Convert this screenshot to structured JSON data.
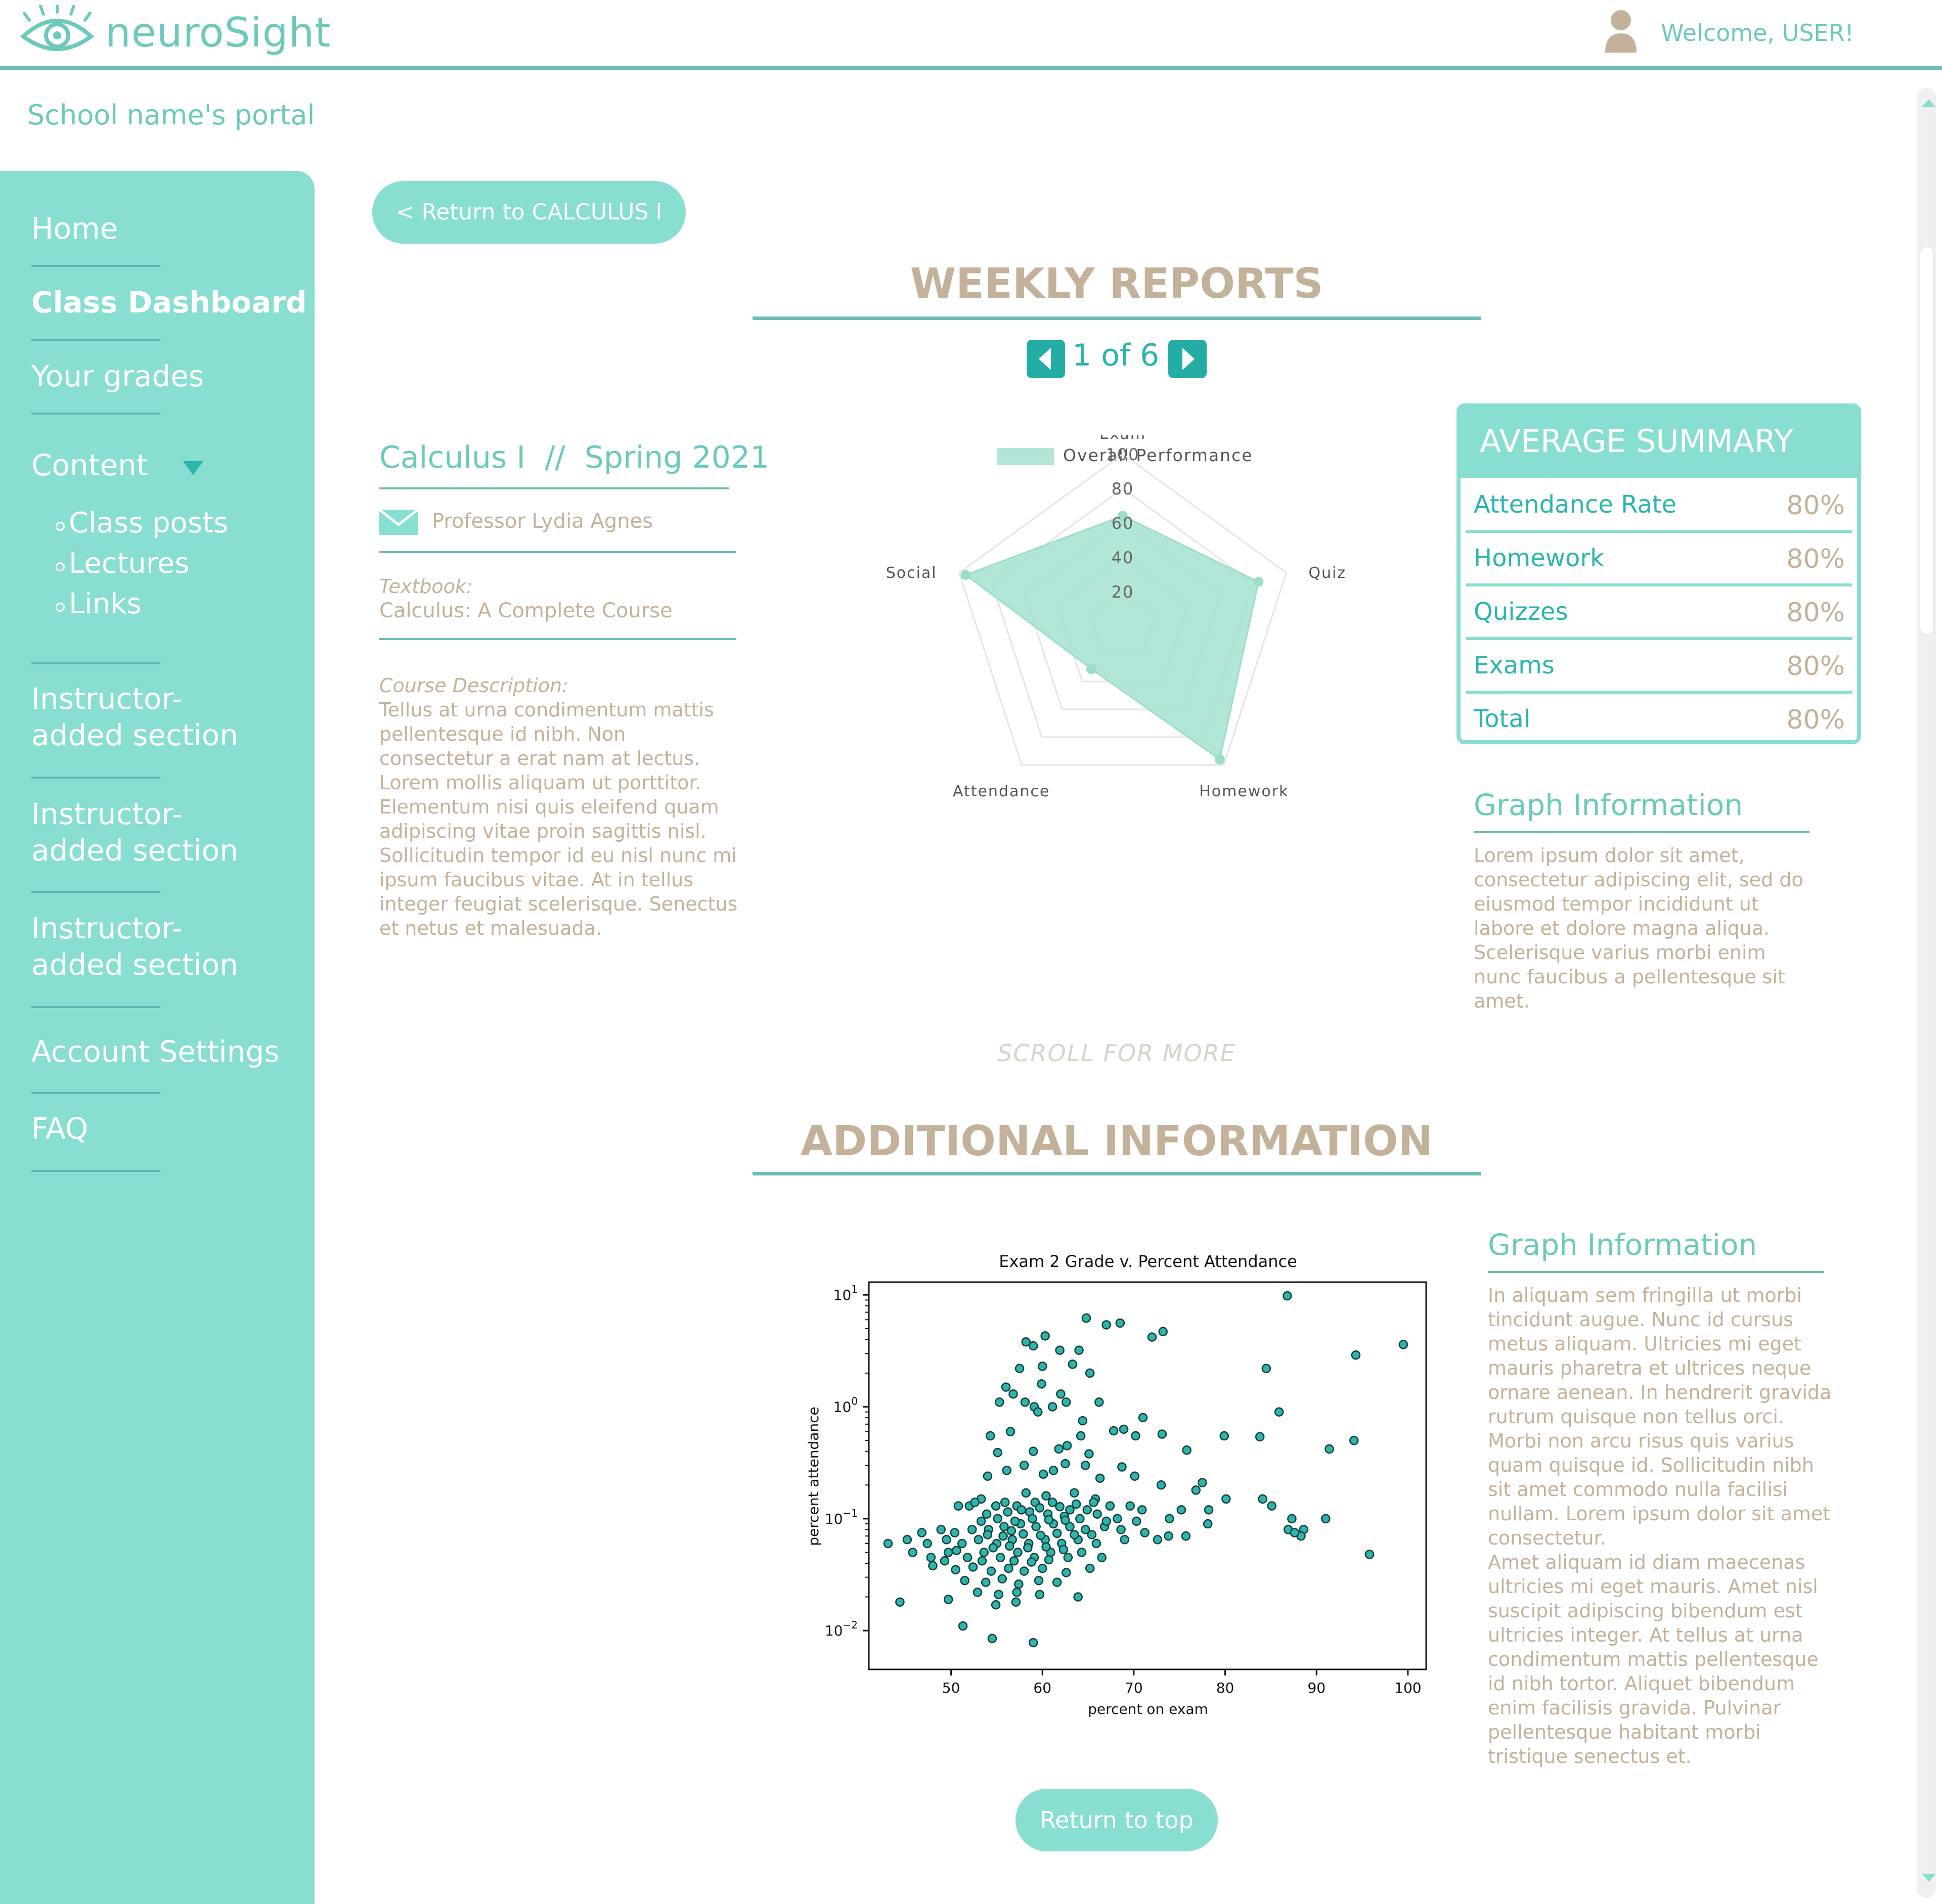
{
  "header": {
    "brand": "neuroSight",
    "welcome": "Welcome, USER!"
  },
  "portal_title": "School name's portal",
  "sidebar": {
    "items": [
      {
        "label": "Home"
      },
      {
        "label": "Class Dashboard"
      },
      {
        "label": "Your grades"
      },
      {
        "label": "Content"
      },
      {
        "label": "Instructor-added section"
      },
      {
        "label": "Instructor-added section"
      },
      {
        "label": "Instructor-added section"
      },
      {
        "label": "Account Settings"
      },
      {
        "label": "FAQ"
      }
    ],
    "content_subitems": [
      "Class posts",
      "Lectures",
      "Links"
    ]
  },
  "return_button": "< Return to CALCULUS I",
  "weekly": {
    "title": "WEEKLY REPORTS",
    "pager": "1 of 6"
  },
  "course": {
    "title": "Calculus I  //  Spring 2021",
    "professor": "Professor Lydia Agnes",
    "textbook_label": "Textbook:",
    "textbook": "Calculus: A Complete Course",
    "description_label": "Course Description:",
    "description": "Tellus at urna condimentum mattis pellentesque id nibh. Non consectetur a erat nam at lectus. Lorem mollis aliquam ut porttitor. Elementum nisi quis eleifend quam adipiscing vitae proin sagittis nisl. Sollicitudin tempor id eu nisl nunc mi ipsum faucibus vitae. At in tellus integer feugiat scelerisque. Senectus et netus et malesuada."
  },
  "summary": {
    "title": "AVERAGE SUMMARY",
    "rows": [
      {
        "label": "Attendance Rate",
        "value": "80%"
      },
      {
        "label": "Homework",
        "value": "80%"
      },
      {
        "label": "Quizzes",
        "value": "80%"
      },
      {
        "label": "Exams",
        "value": "80%"
      },
      {
        "label": "Total",
        "value": "80%"
      }
    ]
  },
  "graph_info_1": {
    "title": "Graph Information",
    "text": "Lorem ipsum dolor sit amet, consectetur adipiscing elit, sed do eiusmod tempor incididunt ut labore et dolore magna aliqua. Scelerisque varius morbi enim nunc faucibus a pellentesque sit amet."
  },
  "scroll_hint": "SCROLL FOR MORE",
  "additional": {
    "title": "ADDITIONAL INFORMATION"
  },
  "graph_info_2": {
    "title": "Graph Information",
    "text1": "In aliquam sem fringilla ut morbi tincidunt augue. Nunc id cursus metus aliquam. Ultricies mi eget mauris pharetra et ultrices neque ornare aenean. In hendrerit gravida rutrum quisque non tellus orci. Morbi non arcu risus quis varius quam quisque id. Sollicitudin nibh sit amet commodo nulla facilisi nullam. Lorem ipsum dolor sit amet consectetur.",
    "text2": "Amet aliquam id diam maecenas ultricies mi eget mauris. Amet nisl suscipit adipiscing bibendum est ultricies integer. At tellus at urna condimentum mattis pellentesque id nibh tortor. Aliquet bibendum enim facilisis gravida. Pulvinar pellentesque habitant morbi tristique senectus et."
  },
  "return_top": "Return to top",
  "colors": {
    "teal": "#88ded0",
    "teal_dark": "#24ada5",
    "tan": "#c3b19a"
  },
  "icons": [
    "eye-logo-icon",
    "user-icon",
    "mail-icon",
    "caret-down-icon",
    "chevron-left-icon",
    "chevron-right-icon"
  ],
  "chart_data": [
    {
      "type": "radar",
      "legend": "Overall Performance",
      "categories": [
        "Exam",
        "Quiz",
        "Homework",
        "Attendance",
        "Social"
      ],
      "values": [
        64,
        83,
        96,
        31,
        96
      ],
      "r_ticks": [
        "20",
        "40",
        "60",
        "80",
        "100"
      ],
      "range": [
        0,
        100
      ]
    },
    {
      "type": "scatter",
      "title": "Exam 2 Grade v. Percent Attendance",
      "xlabel": "percent on exam",
      "ylabel": "percent attendance",
      "x_ticks": [
        50,
        60,
        70,
        80,
        90,
        100
      ],
      "y_ticks": [
        "10",
        "10",
        "10"
      ],
      "y_tick_exponents": [
        "1",
        "0",
        "−1",
        "−2"
      ],
      "y_scale": "log",
      "xlim": [
        41,
        102
      ],
      "ylim": [
        0.0045,
        13
      ],
      "points": [
        [
          86.8,
          9.8
        ],
        [
          64.8,
          6.2
        ],
        [
          67.0,
          5.4
        ],
        [
          68.5,
          5.6
        ],
        [
          73.2,
          4.7
        ],
        [
          72.0,
          4.2
        ],
        [
          60.3,
          4.3
        ],
        [
          58.2,
          3.8
        ],
        [
          59.0,
          3.5
        ],
        [
          61.9,
          3.2
        ],
        [
          64.0,
          3.2
        ],
        [
          99.5,
          3.6
        ],
        [
          94.3,
          2.9
        ],
        [
          84.5,
          2.2
        ],
        [
          57.5,
          2.2
        ],
        [
          60.0,
          2.3
        ],
        [
          63.3,
          2.4
        ],
        [
          65.2,
          2.0
        ],
        [
          56.0,
          1.5
        ],
        [
          56.8,
          1.3
        ],
        [
          59.9,
          1.6
        ],
        [
          62.0,
          1.3
        ],
        [
          55.3,
          1.1
        ],
        [
          58.1,
          1.1
        ],
        [
          59.1,
          1.0
        ],
        [
          61.1,
          1.0
        ],
        [
          62.6,
          1.1
        ],
        [
          66.2,
          1.1
        ],
        [
          71.0,
          0.8
        ],
        [
          85.9,
          0.9
        ],
        [
          59.5,
          0.9
        ],
        [
          64.4,
          0.75
        ],
        [
          68.9,
          0.63
        ],
        [
          70.2,
          0.55
        ],
        [
          56.5,
          0.6
        ],
        [
          54.3,
          0.55
        ],
        [
          64.2,
          0.55
        ],
        [
          67.8,
          0.61
        ],
        [
          73.1,
          0.57
        ],
        [
          79.9,
          0.55
        ],
        [
          83.8,
          0.54
        ],
        [
          94.1,
          0.5
        ],
        [
          91.4,
          0.42
        ],
        [
          55.1,
          0.39
        ],
        [
          59.0,
          0.4
        ],
        [
          61.8,
          0.42
        ],
        [
          62.7,
          0.45
        ],
        [
          65.1,
          0.38
        ],
        [
          75.8,
          0.41
        ],
        [
          64.7,
          0.3
        ],
        [
          58.0,
          0.3
        ],
        [
          61.2,
          0.27
        ],
        [
          62.5,
          0.31
        ],
        [
          68.7,
          0.29
        ],
        [
          54.0,
          0.24
        ],
        [
          56.1,
          0.27
        ],
        [
          60.1,
          0.25
        ],
        [
          66.3,
          0.23
        ],
        [
          70.1,
          0.24
        ],
        [
          73.0,
          0.2
        ],
        [
          77.5,
          0.21
        ],
        [
          76.8,
          0.18
        ],
        [
          80.1,
          0.15
        ],
        [
          84.1,
          0.15
        ],
        [
          85.1,
          0.13
        ],
        [
          53.3,
          0.15
        ],
        [
          55.9,
          0.14
        ],
        [
          58.2,
          0.17
        ],
        [
          60.4,
          0.16
        ],
        [
          63.5,
          0.17
        ],
        [
          65.8,
          0.15
        ],
        [
          50.8,
          0.13
        ],
        [
          52.0,
          0.13
        ],
        [
          54.9,
          0.13
        ],
        [
          57.2,
          0.13
        ],
        [
          59.2,
          0.14
        ],
        [
          61.1,
          0.14
        ],
        [
          63.0,
          0.12
        ],
        [
          64.9,
          0.12
        ],
        [
          67.4,
          0.13
        ],
        [
          69.6,
          0.13
        ],
        [
          70.9,
          0.12
        ],
        [
          75.2,
          0.12
        ],
        [
          78.2,
          0.12
        ],
        [
          87.3,
          0.1
        ],
        [
          91.0,
          0.1
        ],
        [
          73.9,
          0.1
        ],
        [
          78.1,
          0.09
        ],
        [
          86.9,
          0.08
        ],
        [
          88.6,
          0.08
        ],
        [
          88.3,
          0.07
        ],
        [
          87.6,
          0.075
        ],
        [
          46.8,
          0.075
        ],
        [
          48.9,
          0.08
        ],
        [
          50.4,
          0.075
        ],
        [
          52.3,
          0.08
        ],
        [
          54.1,
          0.08
        ],
        [
          55.8,
          0.085
        ],
        [
          57.6,
          0.09
        ],
        [
          59.3,
          0.085
        ],
        [
          61.2,
          0.09
        ],
        [
          63.0,
          0.085
        ],
        [
          64.7,
          0.08
        ],
        [
          66.8,
          0.085
        ],
        [
          68.6,
          0.08
        ],
        [
          71.2,
          0.075
        ],
        [
          73.8,
          0.07
        ],
        [
          75.7,
          0.07
        ],
        [
          43.1,
          0.06
        ],
        [
          45.2,
          0.065
        ],
        [
          47.4,
          0.06
        ],
        [
          49.5,
          0.065
        ],
        [
          51.2,
          0.06
        ],
        [
          53.0,
          0.065
        ],
        [
          55.0,
          0.06
        ],
        [
          56.7,
          0.065
        ],
        [
          58.5,
          0.06
        ],
        [
          60.3,
          0.065
        ],
        [
          62.1,
          0.06
        ],
        [
          63.9,
          0.065
        ],
        [
          65.9,
          0.06
        ],
        [
          69.0,
          0.065
        ],
        [
          72.6,
          0.065
        ],
        [
          45.8,
          0.05
        ],
        [
          47.8,
          0.045
        ],
        [
          49.7,
          0.05
        ],
        [
          51.8,
          0.045
        ],
        [
          53.6,
          0.05
        ],
        [
          55.4,
          0.045
        ],
        [
          57.3,
          0.05
        ],
        [
          59.1,
          0.045
        ],
        [
          60.9,
          0.05
        ],
        [
          62.8,
          0.045
        ],
        [
          64.3,
          0.05
        ],
        [
          66.5,
          0.045
        ],
        [
          95.8,
          0.048
        ],
        [
          48.0,
          0.038
        ],
        [
          50.5,
          0.035
        ],
        [
          52.4,
          0.037
        ],
        [
          54.4,
          0.034
        ],
        [
          56.3,
          0.036
        ],
        [
          58.0,
          0.034
        ],
        [
          60.0,
          0.036
        ],
        [
          62.6,
          0.033
        ],
        [
          65.2,
          0.036
        ],
        [
          51.5,
          0.028
        ],
        [
          53.8,
          0.027
        ],
        [
          55.6,
          0.029
        ],
        [
          57.4,
          0.026
        ],
        [
          59.6,
          0.028
        ],
        [
          61.6,
          0.027
        ],
        [
          52.9,
          0.022
        ],
        [
          55.2,
          0.021
        ],
        [
          57.2,
          0.022
        ],
        [
          59.7,
          0.021
        ],
        [
          44.4,
          0.018
        ],
        [
          49.7,
          0.019
        ],
        [
          54.9,
          0.017
        ],
        [
          57.1,
          0.018
        ],
        [
          63.9,
          0.02
        ],
        [
          51.3,
          0.011
        ],
        [
          54.5,
          0.0085
        ],
        [
          59.0,
          0.0078
        ],
        [
          52.6,
          0.14
        ],
        [
          53.9,
          0.11
        ],
        [
          56.2,
          0.115
        ],
        [
          58.6,
          0.115
        ],
        [
          60.6,
          0.11
        ],
        [
          62.4,
          0.105
        ],
        [
          64.1,
          0.1
        ],
        [
          66.0,
          0.11
        ],
        [
          55.1,
          0.1
        ],
        [
          57.0,
          0.095
        ],
        [
          58.9,
          0.1
        ],
        [
          60.7,
          0.098
        ],
        [
          62.5,
          0.097
        ],
        [
          53.3,
          0.095
        ],
        [
          55.7,
          0.07
        ],
        [
          57.9,
          0.073
        ],
        [
          59.8,
          0.071
        ],
        [
          61.6,
          0.074
        ],
        [
          63.5,
          0.072
        ],
        [
          65.4,
          0.072
        ],
        [
          54.6,
          0.055
        ],
        [
          56.4,
          0.057
        ],
        [
          58.4,
          0.055
        ],
        [
          60.4,
          0.056
        ],
        [
          62.3,
          0.053
        ],
        [
          50.6,
          0.052
        ],
        [
          56.9,
          0.042
        ],
        [
          58.8,
          0.041
        ],
        [
          60.7,
          0.043
        ],
        [
          53.4,
          0.042
        ],
        [
          49.3,
          0.042
        ],
        [
          56.6,
          0.078
        ],
        [
          54.0,
          0.072
        ],
        [
          57.7,
          0.12
        ],
        [
          59.7,
          0.125
        ],
        [
          61.9,
          0.128
        ],
        [
          63.7,
          0.135
        ],
        [
          65.6,
          0.14
        ],
        [
          67.0,
          0.095
        ],
        [
          68.2,
          0.1
        ],
        [
          70.3,
          0.095
        ]
      ]
    }
  ]
}
